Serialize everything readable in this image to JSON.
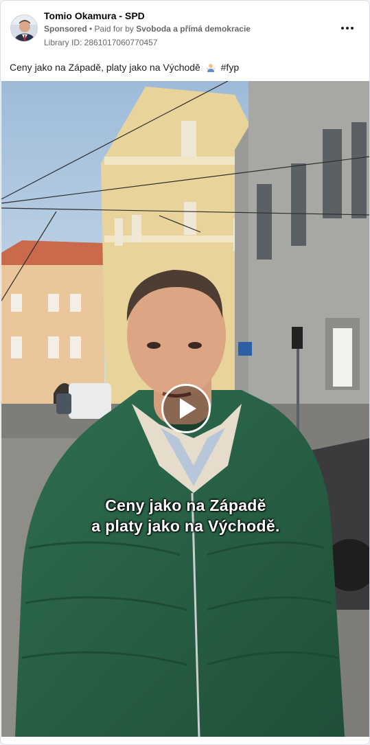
{
  "ad": {
    "page_name": "Tomio Okamura - SPD",
    "sponsored_label": "Sponsored",
    "separator": " • ",
    "paid_for_prefix": "Paid for by ",
    "payer": "Svoboda a přímá demokracie",
    "library_id": "Library ID: 2861017060770457",
    "caption_text": "Ceny jako na Západě, platy jako na Východě",
    "caption_hashtag": "#fyp",
    "more_icon": "more-horizontal-icon"
  },
  "video": {
    "play_icon": "play-icon",
    "subtitle_line1": "Ceny jako na Západě",
    "subtitle_line2": "a platy jako na Východě."
  },
  "colors": {
    "text_primary": "#050505",
    "text_secondary": "#65676b",
    "card_border": "#dadde1",
    "jacket_green": "#2f6b4c"
  }
}
